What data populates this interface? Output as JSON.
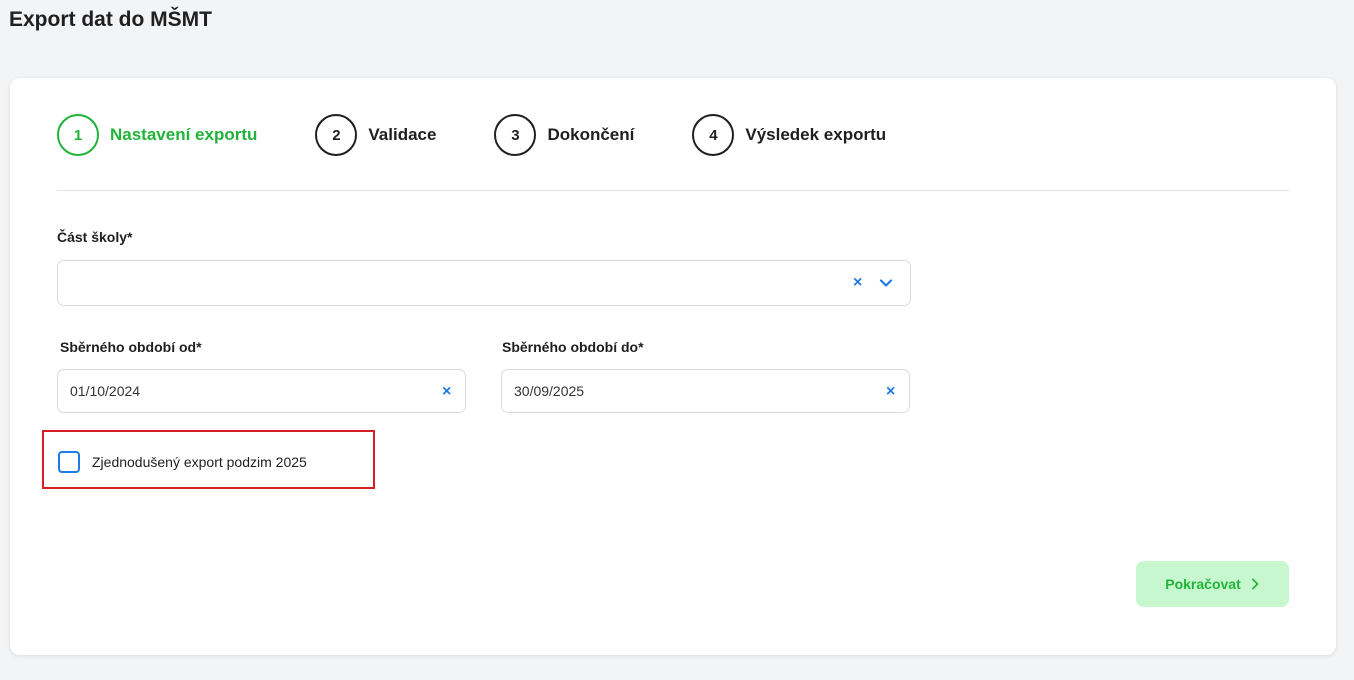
{
  "page": {
    "title": "Export dat do MŠMT"
  },
  "steps": [
    {
      "number": "1",
      "label": "Nastavení exportu",
      "active": true
    },
    {
      "number": "2",
      "label": "Validace",
      "active": false
    },
    {
      "number": "3",
      "label": "Dokončení",
      "active": false
    },
    {
      "number": "4",
      "label": "Výsledek exportu",
      "active": false
    }
  ],
  "form": {
    "school_part": {
      "label": "Část školy*",
      "value": "",
      "clear_icon": "close-icon",
      "dropdown_icon": "chevron-down-icon"
    },
    "period_from": {
      "label": "Sběrného období od*",
      "value": "01/10/2024",
      "clear_icon": "close-icon"
    },
    "period_to": {
      "label": "Sběrného období do*",
      "value": "30/09/2025",
      "clear_icon": "close-icon"
    },
    "simplified_export": {
      "label": "Zjednodušený export podzim 2025",
      "checked": false
    }
  },
  "actions": {
    "continue_label": "Pokračovat",
    "continue_icon": "chevron-right-icon"
  },
  "colors": {
    "active_step": "#22b33a",
    "accent_blue": "#1e7be6",
    "highlight_border": "#d81f26",
    "continue_bg": "#c7f7cf"
  }
}
